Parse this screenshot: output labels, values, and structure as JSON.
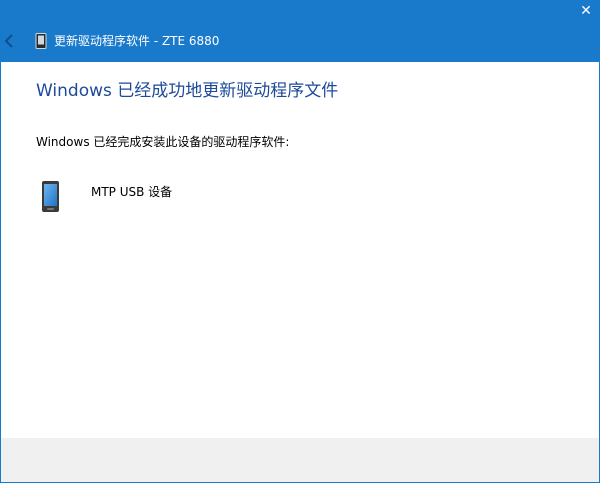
{
  "titlebar": {
    "title": "更新驱动程序软件 - ZTE 6880",
    "close_glyph": "✕",
    "accent_color": "#1979ca"
  },
  "content": {
    "heading": "Windows 已经成功地更新驱动程序文件",
    "subtext": "Windows 已经完成安装此设备的驱动程序软件:",
    "device": {
      "label": "MTP USB 设备",
      "icon": "mobile-device-icon"
    }
  }
}
